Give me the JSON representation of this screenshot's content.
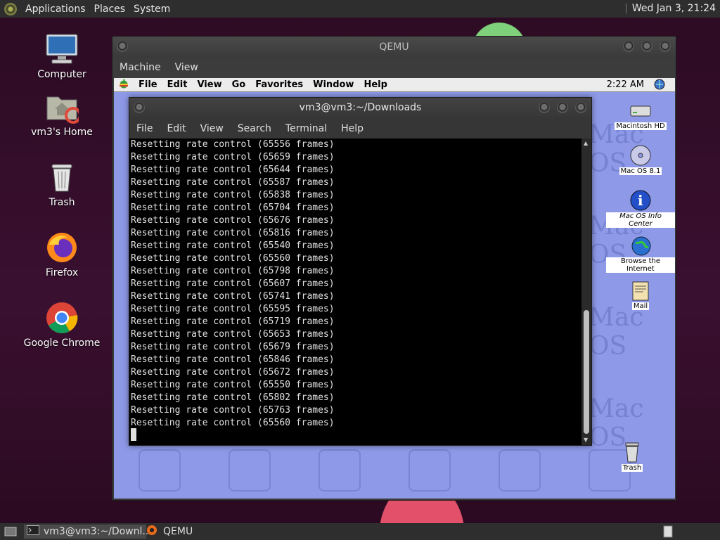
{
  "host": {
    "topbar": {
      "menus": [
        "Applications",
        "Places",
        "System"
      ],
      "clock": "Wed Jan  3, 21:24"
    },
    "desktop_icons": [
      {
        "label": "Computer",
        "icon": "computer-icon"
      },
      {
        "label": "vm3's Home",
        "icon": "home-folder-icon"
      },
      {
        "label": "Trash",
        "icon": "trash-icon"
      },
      {
        "label": "Firefox",
        "icon": "firefox-icon"
      },
      {
        "label": "Google Chrome",
        "icon": "chrome-icon"
      }
    ],
    "taskbar": [
      {
        "label": "vm3@vm3:~/Downl...",
        "icon": "terminal-icon"
      },
      {
        "label": "QEMU",
        "icon": "qemu-icon"
      }
    ]
  },
  "qemu": {
    "title": "QEMU",
    "menu": [
      "Machine",
      "View"
    ]
  },
  "guest": {
    "menubar": [
      "File",
      "Edit",
      "View",
      "Go",
      "Favorites",
      "Window",
      "Help"
    ],
    "time": "2:22 AM",
    "icons": [
      {
        "label": "Macintosh HD",
        "icon": "hard-disk-icon"
      },
      {
        "label": "Mac OS 8.1",
        "icon": "cd-icon"
      },
      {
        "label": "Mac OS Info Center",
        "icon": "info-icon"
      },
      {
        "label": "Browse the Internet",
        "icon": "globe-icon"
      },
      {
        "label": "Mail",
        "icon": "mail-icon"
      },
      {
        "label": "Trash",
        "icon": "trash-icon"
      }
    ],
    "wallpaper_text": "Mac OS"
  },
  "terminal": {
    "title": "vm3@vm3:~/Downloads",
    "menu": [
      "File",
      "Edit",
      "View",
      "Search",
      "Terminal",
      "Help"
    ],
    "lines": [
      "Resetting rate control (65556 frames)",
      "Resetting rate control (65659 frames)",
      "Resetting rate control (65644 frames)",
      "Resetting rate control (65587 frames)",
      "Resetting rate control (65838 frames)",
      "Resetting rate control (65704 frames)",
      "Resetting rate control (65676 frames)",
      "Resetting rate control (65816 frames)",
      "Resetting rate control (65540 frames)",
      "Resetting rate control (65560 frames)",
      "Resetting rate control (65798 frames)",
      "Resetting rate control (65607 frames)",
      "Resetting rate control (65741 frames)",
      "Resetting rate control (65595 frames)",
      "Resetting rate control (65719 frames)",
      "Resetting rate control (65653 frames)",
      "Resetting rate control (65679 frames)",
      "Resetting rate control (65846 frames)",
      "Resetting rate control (65672 frames)",
      "Resetting rate control (65550 frames)",
      "Resetting rate control (65802 frames)",
      "Resetting rate control (65763 frames)",
      "Resetting rate control (65560 frames)"
    ]
  }
}
